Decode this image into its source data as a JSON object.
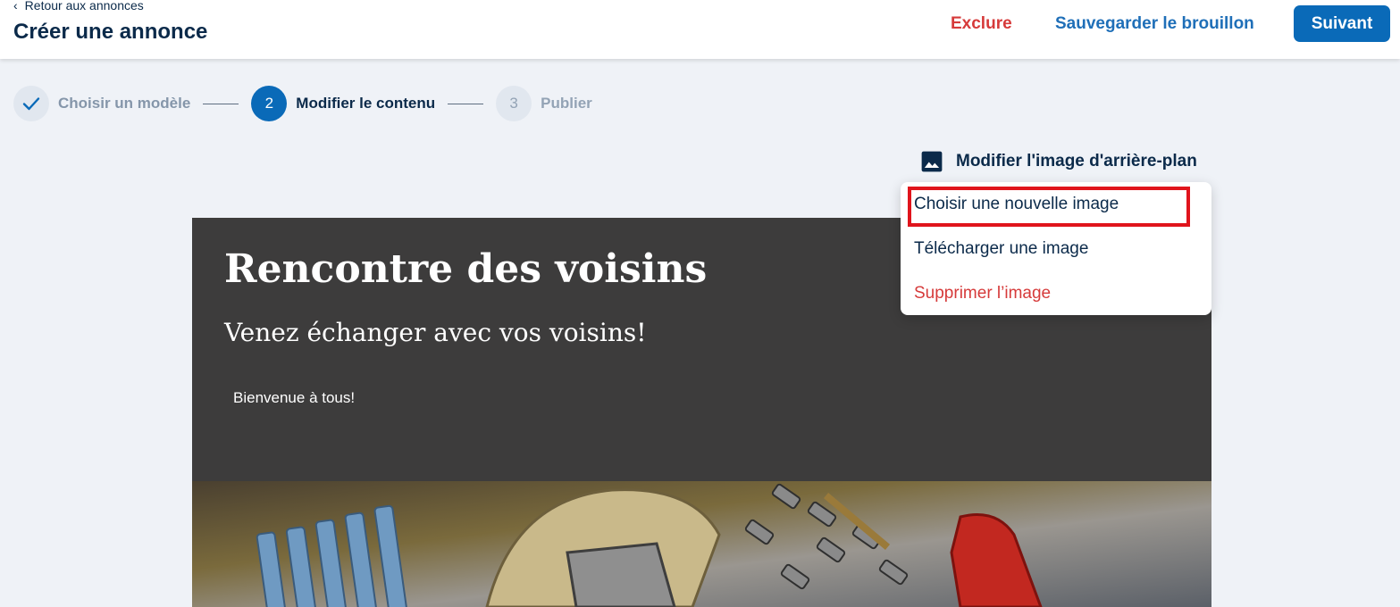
{
  "header": {
    "back_label": "Retour aux annonces",
    "title": "Créer une annonce",
    "exclude_label": "Exclure",
    "save_draft_label": "Sauvegarder le brouillon",
    "next_label": "Suivant"
  },
  "stepper": {
    "steps": [
      {
        "label": "Choisir un modèle",
        "number": "",
        "state": "done"
      },
      {
        "label": "Modifier le contenu",
        "number": "2",
        "state": "active"
      },
      {
        "label": "Publier",
        "number": "3",
        "state": "todo"
      }
    ]
  },
  "background_edit": {
    "label": "Modifier l'image d'arrière-plan",
    "icon": "image-icon"
  },
  "dropdown": {
    "items": [
      {
        "label": "Choisir une nouvelle image",
        "highlighted": true
      },
      {
        "label": "Télécharger une image"
      },
      {
        "label": "Supprimer l’image",
        "danger": true
      }
    ]
  },
  "preview": {
    "title": "Rencontre des voisins",
    "subtitle": "Venez échanger avec vos voisins!",
    "body": "Bienvenue à tous!"
  },
  "colors": {
    "primary": "#0a6ab8",
    "danger": "#d63a3a",
    "text": "#0b2a4a",
    "hero_bg": "#3d3c3c",
    "highlight": "#e0141c"
  }
}
